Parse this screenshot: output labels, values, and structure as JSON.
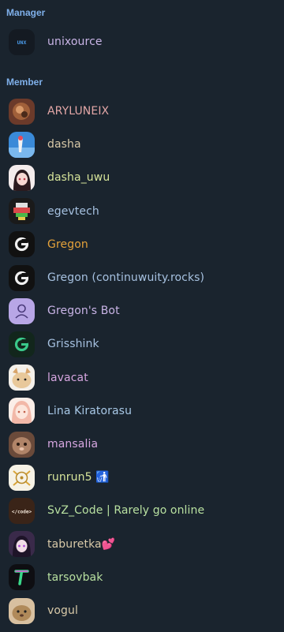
{
  "sections": {
    "manager_title": "Manager",
    "member_title": "Member"
  },
  "managers": [
    {
      "name": "unixource",
      "color": "#c9b4e6",
      "icon": "unx-logo-avatar",
      "avatar_text": "UNX"
    }
  ],
  "members": [
    {
      "name": "ARYLUNEIX",
      "color": "#e2a6a6",
      "icon": "photo-avatar"
    },
    {
      "name": "dasha",
      "color": "#d8c9a8",
      "icon": "photo-avatar"
    },
    {
      "name": "dasha_uwu",
      "color": "#d6e49a",
      "icon": "anime-avatar"
    },
    {
      "name": "egevtech",
      "color": "#a6c1e0",
      "icon": "pixel-avatar"
    },
    {
      "name": "Gregon",
      "color": "#e5a23a",
      "icon": "g-logo-avatar"
    },
    {
      "name": "Gregon (continuwuity.rocks)",
      "color": "#a6c1e0",
      "icon": "g-logo-avatar"
    },
    {
      "name": "Gregon's Bot",
      "color": "#c9b4e6",
      "icon": "person-avatar"
    },
    {
      "name": "Grisshink",
      "color": "#a6c1e0",
      "icon": "g-logo-avatar"
    },
    {
      "name": "lavacat",
      "color": "#d6a6e0",
      "icon": "cat-avatar"
    },
    {
      "name": "Lina Kiratorasu",
      "color": "#a8c8e6",
      "icon": "anime-avatar"
    },
    {
      "name": "mansalia",
      "color": "#d6a6e0",
      "icon": "cat-avatar"
    },
    {
      "name": "runrun5 🚮",
      "color": "#d6e49a",
      "icon": "anime-avatar"
    },
    {
      "name": "SvZ_Code | Rarely go online",
      "color": "#b8e0a0",
      "icon": "code-avatar",
      "avatar_text": "</code>"
    },
    {
      "name": "taburetka💕",
      "color": "#d8c9a8",
      "icon": "anime-avatar"
    },
    {
      "name": "tarsovbak",
      "color": "#b8e0a0",
      "icon": "t-logo-avatar"
    },
    {
      "name": "vogul",
      "color": "#d8c9a8",
      "icon": "animal-avatar"
    }
  ]
}
